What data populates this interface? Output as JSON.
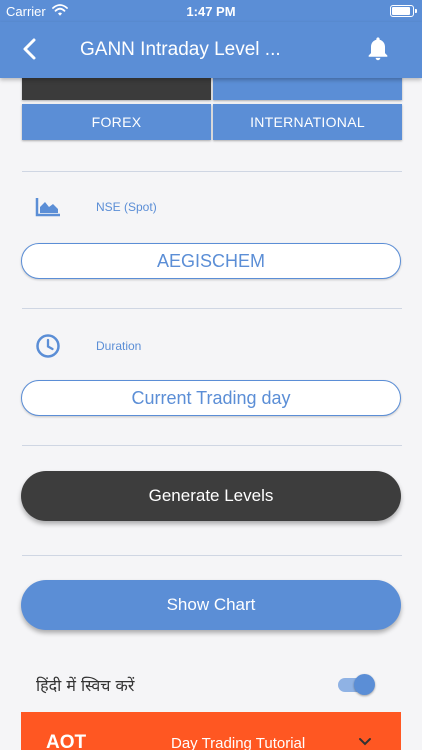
{
  "status_bar": {
    "carrier": "Carrier",
    "time": "1:47 PM"
  },
  "app_bar": {
    "title": "GANN Intraday Level ..."
  },
  "segments": {
    "row1": [
      "",
      ""
    ],
    "row2": [
      "FOREX",
      "INTERNATIONAL"
    ]
  },
  "exchange": {
    "label": "NSE (Spot)",
    "symbol": "AEGISCHEM"
  },
  "duration": {
    "label": "Duration",
    "value": "Current Trading day"
  },
  "actions": {
    "generate_label": "Generate Levels",
    "chart_label": "Show Chart"
  },
  "language": {
    "label": "हिंदी में स्विच करें",
    "enabled": true
  },
  "banner": {
    "brand": "AOT",
    "text": "Day Trading Tutorial"
  },
  "colors": {
    "primary": "#5b8ed6",
    "dark": "#3d3d3d",
    "banner": "#ff5722",
    "background": "#f5f5f7"
  }
}
